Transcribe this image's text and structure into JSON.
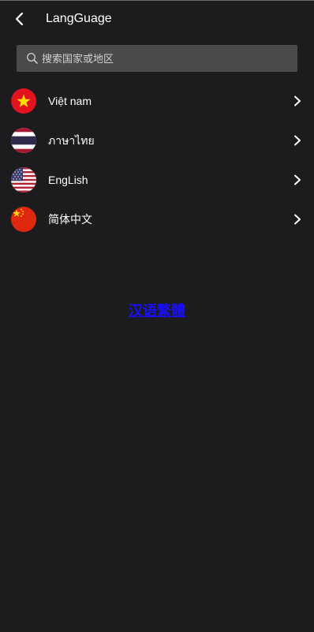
{
  "header": {
    "back_icon": "chevron-left-icon",
    "title": "LangGuage"
  },
  "search": {
    "icon": "search-icon",
    "placeholder": "搜索国家或地区",
    "value": ""
  },
  "languages": [
    {
      "label": "Việt nam",
      "flag": "vietnam-flag-icon"
    },
    {
      "label": "ภาษาไทย",
      "flag": "thailand-flag-icon"
    },
    {
      "label": "EngLish",
      "flag": "usa-flag-icon"
    },
    {
      "label": "简体中文",
      "flag": "china-flag-icon"
    }
  ],
  "center_link": {
    "label": "汉语繁體"
  },
  "colors": {
    "background": "#1c1c1e",
    "search_bg": "#4a4a4a",
    "link": "#1a0dff"
  }
}
